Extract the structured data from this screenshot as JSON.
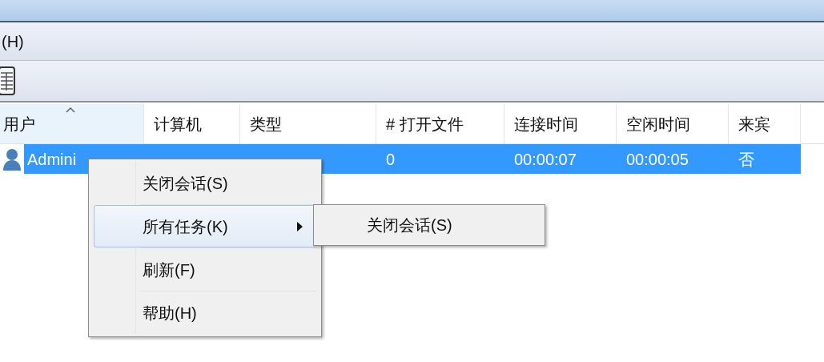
{
  "menu_bar": {
    "items": [
      "(H)"
    ]
  },
  "table": {
    "columns": [
      {
        "label": "用户",
        "sorted": true
      },
      {
        "label": "计算机",
        "sorted": false
      },
      {
        "label": "类型",
        "sorted": false
      },
      {
        "label": "# 打开文件",
        "sorted": false
      },
      {
        "label": "连接时间",
        "sorted": false
      },
      {
        "label": "空闲时间",
        "sorted": false
      },
      {
        "label": "来宾",
        "sorted": false
      }
    ],
    "rows": [
      {
        "selected": true,
        "cells": [
          "Admini",
          "",
          "",
          "0",
          "00:00:07",
          "00:00:05",
          "否"
        ]
      }
    ]
  },
  "context_menu": {
    "items": [
      {
        "label": "关闭会话(S)",
        "selected": false,
        "has_submenu": false
      },
      {
        "label": "所有任务(K)",
        "selected": true,
        "has_submenu": true
      },
      {
        "label": "刷新(F)",
        "selected": false,
        "has_submenu": false
      },
      {
        "label": "帮助(H)",
        "selected": false,
        "has_submenu": false
      }
    ]
  },
  "submenu": {
    "items": [
      "关闭会话(S)"
    ]
  }
}
